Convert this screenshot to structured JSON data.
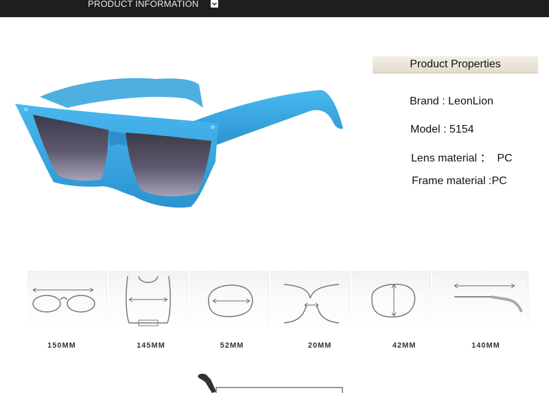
{
  "header": {
    "title": "PRODUCT INFORMATION",
    "chevron_icon": "chevron-down-icon"
  },
  "product": {
    "frame_color": "#3aa9e3",
    "lens_color": "#4e4a60"
  },
  "properties": {
    "title": "Product Properties",
    "items": [
      {
        "label": "Brand : LeonLion"
      },
      {
        "label": "Model : 5154"
      },
      {
        "label": "Lens material ：  PC"
      },
      {
        "label": "Frame material :PC"
      }
    ]
  },
  "dimensions": [
    {
      "label": "150MM",
      "icon": "frame-width-icon"
    },
    {
      "label": "145MM",
      "icon": "temple-spread-icon"
    },
    {
      "label": "52MM",
      "icon": "lens-width-icon"
    },
    {
      "label": "20MM",
      "icon": "bridge-width-icon"
    },
    {
      "label": "42MM",
      "icon": "lens-height-icon"
    },
    {
      "label": "140MM",
      "icon": "temple-length-icon"
    }
  ]
}
